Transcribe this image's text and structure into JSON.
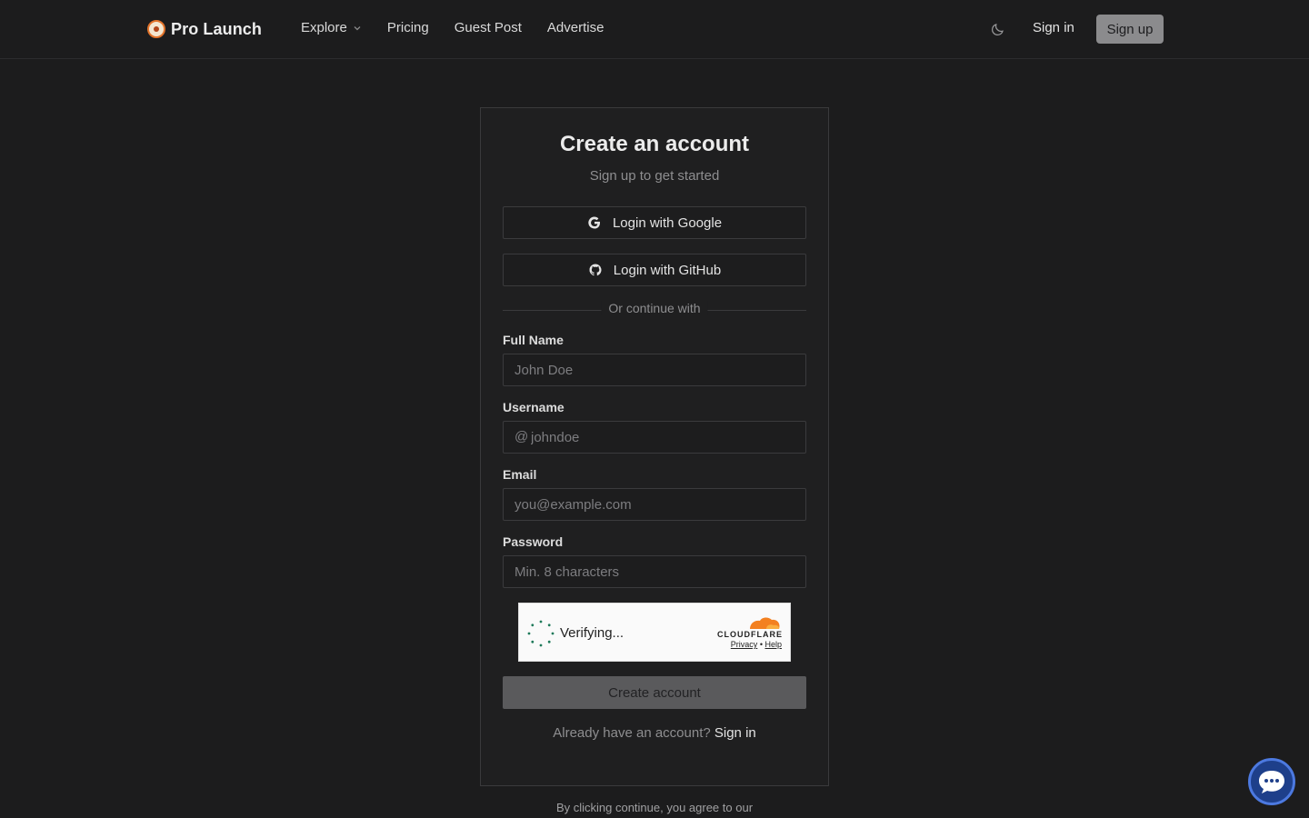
{
  "header": {
    "brand": "Pro Launch",
    "nav": [
      {
        "label": "Explore"
      },
      {
        "label": "Pricing"
      },
      {
        "label": "Guest Post"
      },
      {
        "label": "Advertise"
      }
    ],
    "sign_in": "Sign in",
    "sign_up": "Sign up"
  },
  "card": {
    "title": "Create an account",
    "subtitle": "Sign up to get started",
    "google_label": "Login with Google",
    "github_label": "Login with GitHub",
    "divider": "Or continue with",
    "fields": {
      "full_name": {
        "label": "Full Name",
        "placeholder": "John Doe",
        "value": ""
      },
      "username": {
        "label": "Username",
        "prefix": "@",
        "placeholder": "johndoe",
        "value": ""
      },
      "email": {
        "label": "Email",
        "placeholder": "you@example.com",
        "value": ""
      },
      "password": {
        "label": "Password",
        "placeholder": "Min. 8 characters",
        "value": ""
      }
    },
    "captcha": {
      "status": "Verifying...",
      "provider": "CLOUDFLARE",
      "privacy": "Privacy",
      "separator": "•",
      "help": "Help"
    },
    "submit": "Create account",
    "already_text": "Already have an account?",
    "sign_in_link": "Sign in"
  },
  "footer": {
    "terms": "By clicking continue, you agree to our"
  },
  "colors": {
    "background": "#1c1c1d",
    "signup_button": "#8b8b8d",
    "create_button": "#5a5a5c",
    "cloudflare_orange": "#f38020",
    "chat_bubble": "#1e3f8a"
  },
  "icons": [
    "brand-logo-icon",
    "chevron-down-icon",
    "moon-icon",
    "google-icon",
    "github-icon",
    "spinner-icon",
    "cloudflare-logo-icon",
    "chat-icon"
  ]
}
